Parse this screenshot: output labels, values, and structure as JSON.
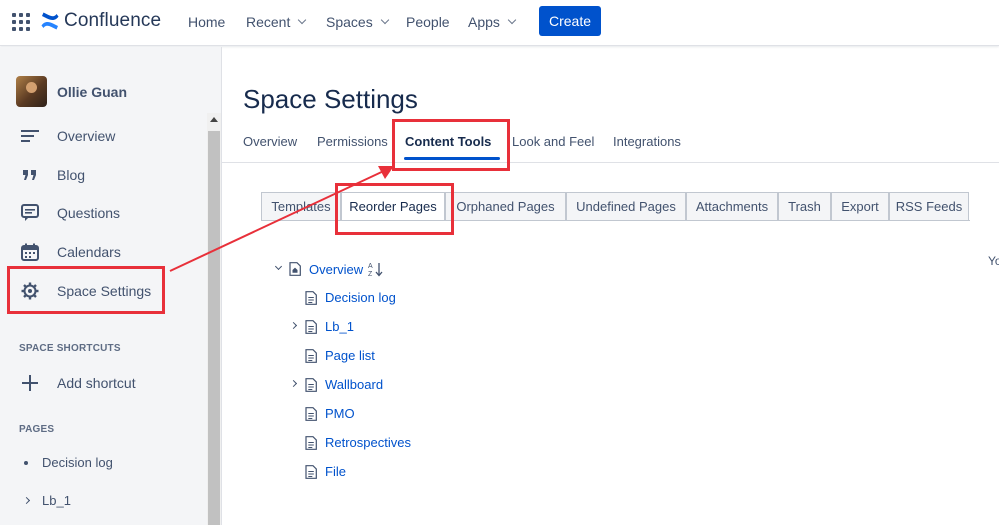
{
  "topnav": {
    "brand": "Confluence",
    "items": [
      "Home",
      "Recent",
      "Spaces",
      "People",
      "Apps"
    ],
    "create_label": "Create"
  },
  "sidebar": {
    "user_name": "Ollie Guan",
    "nav": [
      "Overview",
      "Blog",
      "Questions",
      "Calendars",
      "Space Settings"
    ],
    "shortcuts_label": "SPACE SHORTCUTS",
    "add_shortcut": "Add shortcut",
    "pages_label": "PAGES",
    "pages": [
      "Decision log",
      "Lb_1"
    ]
  },
  "main": {
    "title": "Space Settings",
    "tabs": [
      "Overview",
      "Permissions",
      "Content Tools",
      "Look and Feel",
      "Integrations"
    ],
    "subtabs": [
      "Templates",
      "Reorder Pages",
      "Orphaned Pages",
      "Undefined Pages",
      "Attachments",
      "Trash",
      "Export",
      "RSS Feeds"
    ],
    "right_fragment": "Yo",
    "tree": {
      "root": "Overview",
      "children": [
        "Decision log",
        "Lb_1",
        "Page list",
        "Wallboard",
        "PMO",
        "Retrospectives",
        "File"
      ]
    }
  },
  "colors": {
    "accent": "#0052cc",
    "annotation_red": "#e8303a"
  }
}
